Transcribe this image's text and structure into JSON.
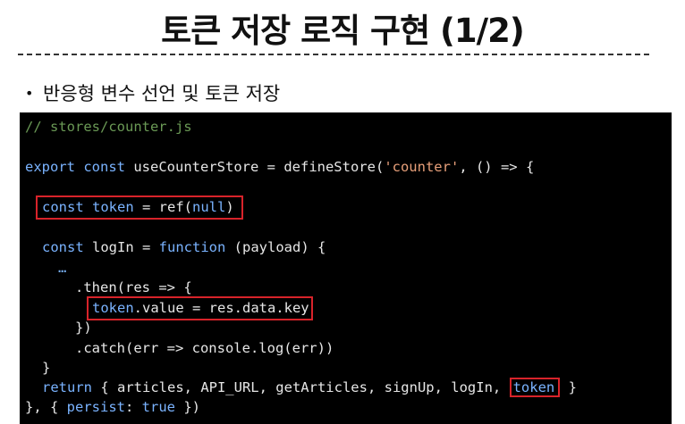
{
  "slide": {
    "title": "토큰 저장 로직 구현 (1/2)",
    "bullet_marker": "•",
    "bullet_text": "반응형 변수 선언 및 토큰 저장"
  },
  "code": {
    "comment": "// stores/counter.js",
    "line_export_kw1": "export",
    "line_export_kw2": "const",
    "line_export_rest": " useCounterStore = defineStore(",
    "line_export_str": "'counter'",
    "line_export_tail": ", () => {",
    "token_kw": "const",
    "token_name": " token",
    "token_rest": " = ref(",
    "token_null": "null",
    "token_close": ")",
    "login_kw": "const",
    "login_rest": " logIn = ",
    "login_fn": "function",
    "login_tail": " (payload) {",
    "ellipsis": "…",
    "then_line": ".then(res => {",
    "assign_token": "token",
    "assign_rest": ".value = res.data.key",
    "close_then": "})",
    "catch_line": ".catch(err => console.log(err))",
    "close_fn": "}",
    "return_kw": "return",
    "return_rest": " { articles, API_URL, getArticles, signUp, logIn, ",
    "return_token": "token",
    "return_close": " }",
    "final_open": "}, { ",
    "final_key": "persist",
    "final_colon": ": ",
    "final_true": "true",
    "final_close": " })"
  },
  "colors": {
    "highlight_box": "#d8232a",
    "code_background": "#000000",
    "comment": "#6a9955",
    "keyword": "#7ab3ff",
    "string": "#e8a07a"
  }
}
